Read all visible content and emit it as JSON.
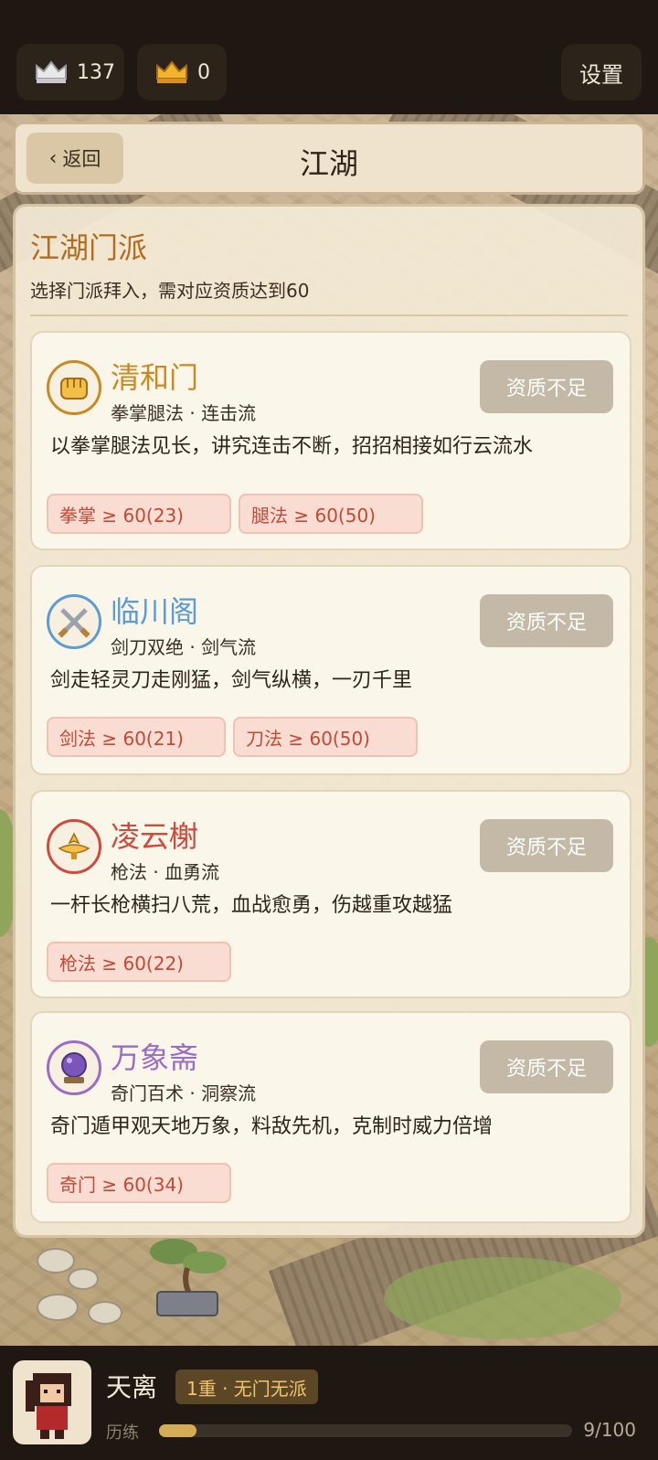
{
  "top_bar": {
    "silver_count": "137",
    "gold_count": "0",
    "settings_label": "设置"
  },
  "header": {
    "back_label": "返回",
    "title": "江湖"
  },
  "section": {
    "title": "江湖门派",
    "subtitle": "选择门派拜入，需对应资质达到60"
  },
  "sects": [
    {
      "name": "清和门",
      "tags": "拳掌腿法 · 连击流",
      "description": "以拳掌腿法见长，讲究连击不断，招招相接如行云流水",
      "status": "资质不足",
      "icon": "fist-icon",
      "accent": "#c98a22",
      "requirements": [
        {
          "label": "拳掌 ≥  60(23)"
        },
        {
          "label": "腿法 ≥  60(50)"
        }
      ]
    },
    {
      "name": "临川阁",
      "tags": "剑刀双绝 · 剑气流",
      "description": "剑走轻灵刀走刚猛，剑气纵横，一刃千里",
      "status": "资质不足",
      "icon": "crossed-swords-icon",
      "accent": "#5b9bd6",
      "requirements": [
        {
          "label": "剑法 ≥  60(21)"
        },
        {
          "label": "刀法 ≥  60(50)"
        }
      ]
    },
    {
      "name": "凌云榭",
      "tags": "枪法 · 血勇流",
      "description": "一杆长枪横扫八荒，血战愈勇，伤越重攻越猛",
      "status": "资质不足",
      "icon": "spear-crest-icon",
      "accent": "#cf4a3c",
      "requirements": [
        {
          "label": "枪法 ≥  60(22)"
        }
      ]
    },
    {
      "name": "万象斋",
      "tags": "奇门百术 · 洞察流",
      "description": "奇门遁甲观天地万象，料敌先机，克制时威力倍增",
      "status": "资质不足",
      "icon": "crystal-ball-icon",
      "accent": "#9a6cc8",
      "requirements": [
        {
          "label": "奇门 ≥  60(34)"
        }
      ]
    }
  ],
  "player": {
    "name": "天离",
    "rank": "1重 · 无门无派",
    "xp_label": "历练",
    "xp_text": "9/100",
    "xp_fraction": 0.09
  },
  "colors": {
    "bar_bg": "#1f1812",
    "panel_bg": "#f4ead6",
    "status_btn": "#c4b9a6",
    "req_bg": "#f9dcd2",
    "req_text": "#c24a36",
    "section_title": "#b06c1f",
    "xp_fill": "#d4ac55"
  }
}
